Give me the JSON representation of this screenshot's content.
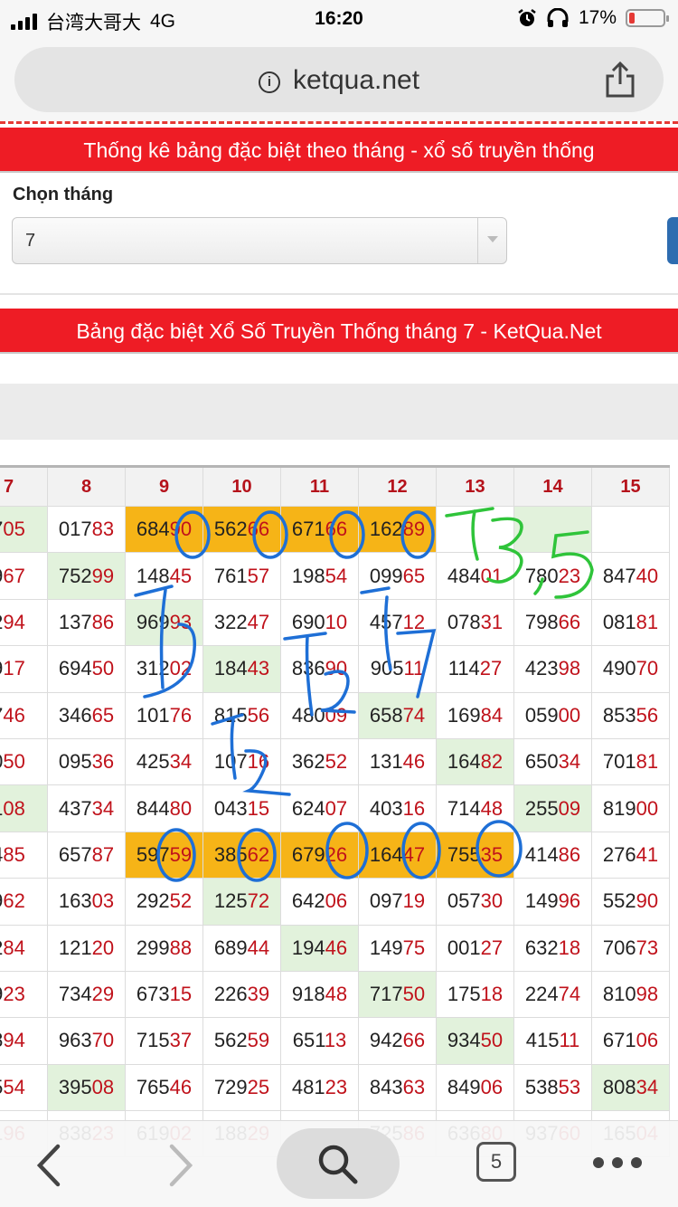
{
  "status_bar": {
    "carrier": "台湾大哥大",
    "network": "4G",
    "time": "16:20",
    "battery": "17%",
    "battery_level": 0.17
  },
  "browser": {
    "url": "ketqua.net"
  },
  "page": {
    "header_title": "Thống kê bảng đặc biệt theo tháng - xổ số truyền thống",
    "select_label": "Chọn tháng",
    "select_value": "7",
    "table_title": "Bảng đặc biệt Xổ Số Truyền Thống tháng 7 - KetQua.Net"
  },
  "table": {
    "columns": [
      "7",
      "8",
      "9",
      "10",
      "11",
      "12",
      "13",
      "14",
      "15"
    ],
    "rows": [
      [
        [
          "7",
          "05"
        ],
        [
          "017",
          "83"
        ],
        [
          "684",
          "90"
        ],
        [
          "562",
          "66"
        ],
        [
          "671",
          "66"
        ],
        [
          "162",
          "89"
        ],
        [
          "",
          ""
        ],
        [
          "",
          ""
        ],
        [
          "",
          ""
        ]
      ],
      [
        [
          "9",
          "67"
        ],
        [
          "752",
          "99"
        ],
        [
          "148",
          "45"
        ],
        [
          "761",
          "57"
        ],
        [
          "198",
          "54"
        ],
        [
          "099",
          "65"
        ],
        [
          "484",
          "01"
        ],
        [
          "780",
          "23"
        ],
        [
          "847",
          "40"
        ]
      ],
      [
        [
          "2",
          "94"
        ],
        [
          "137",
          "86"
        ],
        [
          "969",
          "93"
        ],
        [
          "322",
          "47"
        ],
        [
          "690",
          "10"
        ],
        [
          "457",
          "12"
        ],
        [
          "078",
          "31"
        ],
        [
          "798",
          "66"
        ],
        [
          "081",
          "81"
        ]
      ],
      [
        [
          "9",
          "17"
        ],
        [
          "694",
          "50"
        ],
        [
          "312",
          "02"
        ],
        [
          "184",
          "43"
        ],
        [
          "836",
          "90"
        ],
        [
          "905",
          "11"
        ],
        [
          "114",
          "27"
        ],
        [
          "423",
          "98"
        ],
        [
          "490",
          "70"
        ]
      ],
      [
        [
          "7",
          "46"
        ],
        [
          "346",
          "65"
        ],
        [
          "101",
          "76"
        ],
        [
          "815",
          "56"
        ],
        [
          "480",
          "09"
        ],
        [
          "658",
          "74"
        ],
        [
          "169",
          "84"
        ],
        [
          "059",
          "00"
        ],
        [
          "853",
          "56"
        ]
      ],
      [
        [
          "0",
          "50"
        ],
        [
          "095",
          "36"
        ],
        [
          "425",
          "34"
        ],
        [
          "107",
          "16"
        ],
        [
          "362",
          "52"
        ],
        [
          "131",
          "46"
        ],
        [
          "164",
          "82"
        ],
        [
          "650",
          "34"
        ],
        [
          "701",
          "81"
        ]
      ],
      [
        [
          "1",
          "08"
        ],
        [
          "437",
          "34"
        ],
        [
          "844",
          "80"
        ],
        [
          "043",
          "15"
        ],
        [
          "624",
          "07"
        ],
        [
          "403",
          "16"
        ],
        [
          "714",
          "48"
        ],
        [
          "255",
          "09"
        ],
        [
          "819",
          "00"
        ]
      ],
      [
        [
          "4",
          "85"
        ],
        [
          "657",
          "87"
        ],
        [
          "597",
          "59"
        ],
        [
          "385",
          "62"
        ],
        [
          "679",
          "26"
        ],
        [
          "164",
          "47"
        ],
        [
          "755",
          "35"
        ],
        [
          "414",
          "86"
        ],
        [
          "276",
          "41"
        ]
      ],
      [
        [
          "9",
          "62"
        ],
        [
          "163",
          "03"
        ],
        [
          "292",
          "52"
        ],
        [
          "125",
          "72"
        ],
        [
          "642",
          "06"
        ],
        [
          "097",
          "19"
        ],
        [
          "057",
          "30"
        ],
        [
          "149",
          "96"
        ],
        [
          "552",
          "90"
        ]
      ],
      [
        [
          "2",
          "84"
        ],
        [
          "121",
          "20"
        ],
        [
          "299",
          "88"
        ],
        [
          "689",
          "44"
        ],
        [
          "194",
          "46"
        ],
        [
          "149",
          "75"
        ],
        [
          "001",
          "27"
        ],
        [
          "632",
          "18"
        ],
        [
          "706",
          "73"
        ]
      ],
      [
        [
          "9",
          "23"
        ],
        [
          "734",
          "29"
        ],
        [
          "673",
          "15"
        ],
        [
          "226",
          "39"
        ],
        [
          "918",
          "48"
        ],
        [
          "717",
          "50"
        ],
        [
          "175",
          "18"
        ],
        [
          "224",
          "74"
        ],
        [
          "810",
          "98"
        ]
      ],
      [
        [
          "8",
          "94"
        ],
        [
          "963",
          "70"
        ],
        [
          "715",
          "37"
        ],
        [
          "562",
          "59"
        ],
        [
          "651",
          "13"
        ],
        [
          "942",
          "66"
        ],
        [
          "934",
          "50"
        ],
        [
          "415",
          "11"
        ],
        [
          "671",
          "06"
        ]
      ],
      [
        [
          "5",
          "54"
        ],
        [
          "395",
          "08"
        ],
        [
          "765",
          "46"
        ],
        [
          "729",
          "25"
        ],
        [
          "481",
          "23"
        ],
        [
          "843",
          "63"
        ],
        [
          "849",
          "06"
        ],
        [
          "538",
          "53"
        ],
        [
          "808",
          "34"
        ]
      ],
      [
        [
          "1",
          "96"
        ],
        [
          "838",
          "23"
        ],
        [
          "619",
          "02"
        ],
        [
          "188",
          "29"
        ],
        [
          "",
          ""
        ],
        [
          "725",
          "86"
        ],
        [
          "636",
          "80"
        ],
        [
          "937",
          "60"
        ],
        [
          "165",
          "04"
        ]
      ]
    ],
    "cell_styles": [
      [
        "g",
        "",
        "y",
        "y",
        "y",
        "y",
        "",
        "g",
        ""
      ],
      [
        "",
        "g",
        "",
        "",
        "",
        "",
        "",
        "",
        ""
      ],
      [
        "",
        "",
        "g",
        "",
        "",
        "",
        "",
        "",
        ""
      ],
      [
        "",
        "",
        "",
        "g",
        "",
        "",
        "",
        "",
        ""
      ],
      [
        "",
        "",
        "",
        "",
        "",
        "g",
        "",
        "",
        ""
      ],
      [
        "",
        "",
        "",
        "",
        "",
        "",
        "g",
        "",
        ""
      ],
      [
        "g",
        "",
        "",
        "",
        "",
        "",
        "",
        "g",
        ""
      ],
      [
        "",
        "",
        "y",
        "y",
        "y",
        "y",
        "y",
        "",
        ""
      ],
      [
        "",
        "",
        "",
        "g",
        "",
        "",
        "",
        "",
        ""
      ],
      [
        "",
        "",
        "",
        "",
        "g",
        "",
        "",
        "",
        ""
      ],
      [
        "",
        "",
        "",
        "",
        "",
        "g",
        "",
        "",
        ""
      ],
      [
        "",
        "",
        "",
        "",
        "",
        "",
        "g",
        "",
        ""
      ],
      [
        "",
        "g",
        "",
        "",
        "",
        "",
        "",
        "",
        "g"
      ],
      [
        "",
        "",
        "",
        "",
        "",
        "",
        "",
        "",
        ""
      ]
    ],
    "colors": {
      "highlight": "#f6b417",
      "green": "#e2f2dc",
      "special_digits": "#c0121b"
    }
  },
  "annotations": [
    "T3,5",
    "T9",
    "T2",
    "T7",
    "T2"
  ],
  "toolbar": {
    "tab_count": "5",
    "icons": [
      "back-chevron-icon",
      "forward-chevron-icon",
      "search-icon",
      "tabs-icon",
      "more-icon"
    ]
  }
}
